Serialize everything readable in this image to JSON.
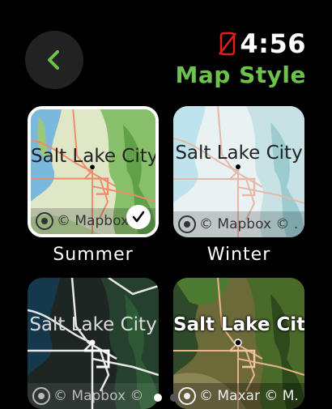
{
  "header": {
    "time": "4:56",
    "title": "Map Style",
    "accent_color": "#6cc24a",
    "status_icon": "phone-disconnected-icon"
  },
  "styles": [
    {
      "label": "Summer",
      "city": "Salt Lake City",
      "attribution": "© Mapbox ©",
      "selected": true
    },
    {
      "label": "Winter",
      "city": "Salt Lake City",
      "attribution": "© Mapbox © ."
    },
    {
      "label": "",
      "city": "Salt Lake City",
      "attribution": "© Mapbox ©"
    },
    {
      "label": "",
      "city": "Salt Lake City",
      "attribution": "© Maxar © M."
    }
  ],
  "pager": {
    "count": 2,
    "active": 0
  }
}
